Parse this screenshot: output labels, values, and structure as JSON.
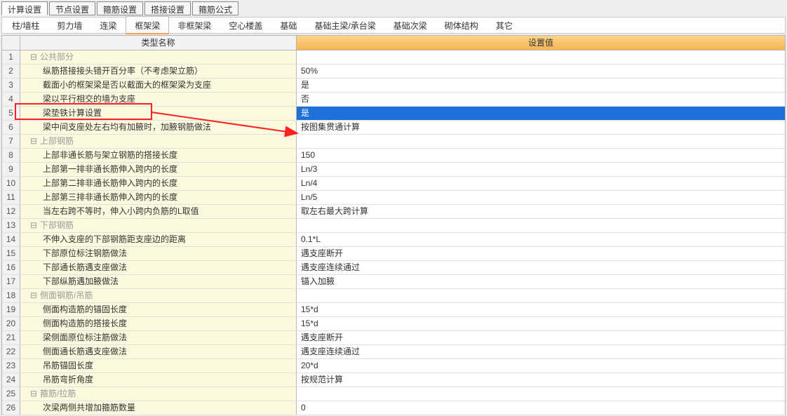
{
  "top_tabs": {
    "calc": "计算设置",
    "node": "节点设置",
    "stirrup": "箍筋设置",
    "lap": "搭接设置",
    "formula": "箍筋公式"
  },
  "sub_tabs": {
    "col_wall": "柱/墙柱",
    "shear_wall": "剪力墙",
    "conn_beam": "连梁",
    "frame_beam": "框架梁",
    "nonframe_beam": "非框架梁",
    "hollow_slab": "空心楼盖",
    "foundation": "基础",
    "foundation_main": "基础主梁/承台梁",
    "foundation_sec": "基础次梁",
    "masonry": "砌体结构",
    "other": "其它"
  },
  "headers": {
    "name": "类型名称",
    "value": "设置值"
  },
  "rows": [
    {
      "n": "1",
      "group": true,
      "name": "公共部分",
      "value": ""
    },
    {
      "n": "2",
      "child": true,
      "name": "纵筋搭接接头错开百分率（不考虑架立筋）",
      "value": "50%"
    },
    {
      "n": "3",
      "child": true,
      "name": "截面小的框架梁是否以截面大的框架梁为支座",
      "value": "是"
    },
    {
      "n": "4",
      "child": true,
      "name": "梁以平行相交的墙为支座",
      "value": "否"
    },
    {
      "n": "5",
      "child": true,
      "name": "梁垫铁计算设置",
      "value": "是",
      "selected": true
    },
    {
      "n": "6",
      "child": true,
      "name": "梁中间支座处左右均有加腋时，加腋钢筋做法",
      "value": "按图集贯通计算"
    },
    {
      "n": "7",
      "group": true,
      "name": "上部钢筋",
      "value": ""
    },
    {
      "n": "8",
      "child": true,
      "name": "上部非通长筋与架立钢筋的搭接长度",
      "value": "150"
    },
    {
      "n": "9",
      "child": true,
      "name": "上部第一排非通长筋伸入跨内的长度",
      "value": "Ln/3"
    },
    {
      "n": "10",
      "child": true,
      "name": "上部第二排非通长筋伸入跨内的长度",
      "value": "Ln/4"
    },
    {
      "n": "11",
      "child": true,
      "name": "上部第三排非通长筋伸入跨内的长度",
      "value": "Ln/5"
    },
    {
      "n": "12",
      "child": true,
      "name": "当左右跨不等时，伸入小跨内负筋的L取值",
      "value": "取左右最大跨计算"
    },
    {
      "n": "13",
      "group": true,
      "name": "下部钢筋",
      "value": ""
    },
    {
      "n": "14",
      "child": true,
      "name": "不伸入支座的下部钢筋距支座边的距离",
      "value": "0.1*L"
    },
    {
      "n": "15",
      "child": true,
      "name": "下部原位标注钢筋做法",
      "value": "遇支座断开"
    },
    {
      "n": "16",
      "child": true,
      "name": "下部通长筋遇支座做法",
      "value": "遇支座连续通过"
    },
    {
      "n": "17",
      "child": true,
      "name": "下部纵筋遇加腋做法",
      "value": "锚入加腋"
    },
    {
      "n": "18",
      "group": true,
      "name": "侧面钢筋/吊筋",
      "value": ""
    },
    {
      "n": "19",
      "child": true,
      "name": "侧面构造筋的锚固长度",
      "value": "15*d"
    },
    {
      "n": "20",
      "child": true,
      "name": "侧面构造筋的搭接长度",
      "value": "15*d"
    },
    {
      "n": "21",
      "child": true,
      "name": "梁侧面原位标注筋做法",
      "value": "遇支座断开"
    },
    {
      "n": "22",
      "child": true,
      "name": "侧面通长筋遇支座做法",
      "value": "遇支座连续通过"
    },
    {
      "n": "23",
      "child": true,
      "name": "吊筋锚固长度",
      "value": "20*d"
    },
    {
      "n": "24",
      "child": true,
      "name": "吊筋弯折角度",
      "value": "按规范计算"
    },
    {
      "n": "25",
      "group": true,
      "name": "箍筋/拉筋",
      "value": ""
    },
    {
      "n": "26",
      "child": true,
      "name": "次梁两侧共增加箍筋数量",
      "value": "0"
    }
  ],
  "annotation": {
    "color": "#ff2020"
  }
}
